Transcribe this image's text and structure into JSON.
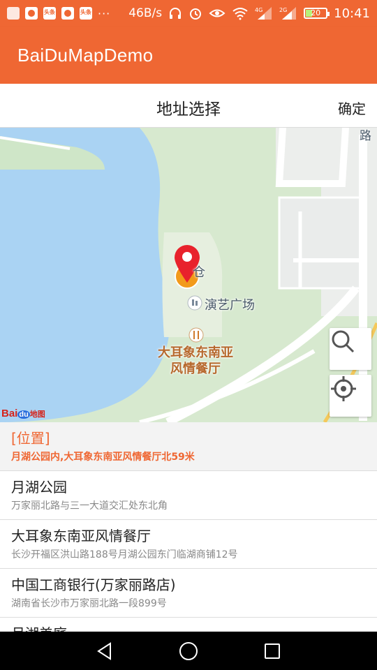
{
  "status_bar": {
    "net_speed": "46B/s",
    "battery_level": "20",
    "time": "10:41",
    "dots": "···",
    "icons": [
      "app-icon",
      "map-pin-app-icon",
      "toutiao-icon",
      "map-pin-app-icon",
      "toutiao-icon",
      "headphones-icon",
      "alarm-icon",
      "eye-icon",
      "wifi-icon",
      "signal-4g-icon",
      "signal-2g-icon",
      "battery-icon"
    ],
    "signal_labels": [
      "4G",
      "2G"
    ],
    "app_tags": [
      "头条",
      "头条"
    ]
  },
  "toolbar": {
    "title": "BaiDuMapDemo"
  },
  "header": {
    "title": "地址选择",
    "confirm_label": "确定"
  },
  "map": {
    "labels": {
      "partial_warehouse": "仓",
      "plaza": "演艺广场",
      "restaurant_line1": "大耳象东南亚",
      "restaurant_line2": "风情餐厅",
      "road_edge": "路"
    },
    "logo": {
      "bai": "Bai",
      "du": "du",
      "map": "地图"
    },
    "buttons": {
      "search": "search-icon",
      "locate": "crosshair-icon"
    },
    "colors": {
      "water": "#aad3f3",
      "park": "#cfe6c8",
      "road": "#ffffff",
      "pin": "#e8222c"
    }
  },
  "results": [
    {
      "name": "[位置]",
      "address": "月湖公园内,大耳象东南亚风情餐厅北59米"
    },
    {
      "name": "月湖公园",
      "address": "万家丽北路与三一大道交汇处东北角"
    },
    {
      "name": "大耳象东南亚风情餐厅",
      "address": "长沙开福区洪山路188号月湖公园东门临湖商铺12号"
    },
    {
      "name": "中国工商银行(万家丽路店)",
      "address": "湖南省长沙市万家丽北路一段899号"
    },
    {
      "name": "月湖美庭",
      "address": ""
    }
  ],
  "nav": {
    "icons": [
      "back-triangle-icon",
      "home-circle-icon",
      "recents-square-icon"
    ]
  },
  "accent_color": "#ef6733"
}
